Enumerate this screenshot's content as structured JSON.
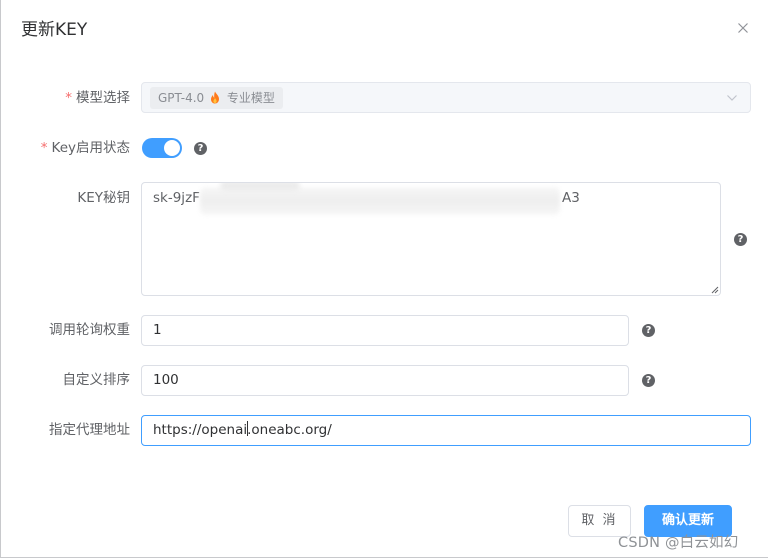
{
  "dialog": {
    "title": "更新KEY",
    "close_icon": "close-icon"
  },
  "form": {
    "required_mark": "*",
    "model": {
      "label": "模型选择",
      "required": true,
      "selected_value": "GPT-4.0",
      "tag_suffix": "专业模型",
      "tag_icon": "flame-icon",
      "disabled": true
    },
    "key_status": {
      "label": "Key启用状态",
      "required": true,
      "enabled": true,
      "help_icon": "question-circle-icon"
    },
    "secret": {
      "label": "KEY秘钥",
      "value_prefix": "sk-9jzF",
      "value_suffix": "A3",
      "redacted": true,
      "help_icon": "question-circle-icon"
    },
    "weight": {
      "label": "调用轮询权重",
      "value": "1",
      "help_icon": "question-circle-icon"
    },
    "sort": {
      "label": "自定义排序",
      "value": "100",
      "help_icon": "question-circle-icon"
    },
    "proxy": {
      "label": "指定代理地址",
      "value_before_caret": "https://openai",
      "value_after_caret": ".oneabc.org/"
    }
  },
  "footer": {
    "cancel_label": "取 消",
    "confirm_label": "确认更新"
  },
  "watermark": "CSDN @白云如幻",
  "colors": {
    "primary": "#409eff",
    "required": "#f56c6c",
    "label": "#606266",
    "border": "#dcdfe6"
  }
}
